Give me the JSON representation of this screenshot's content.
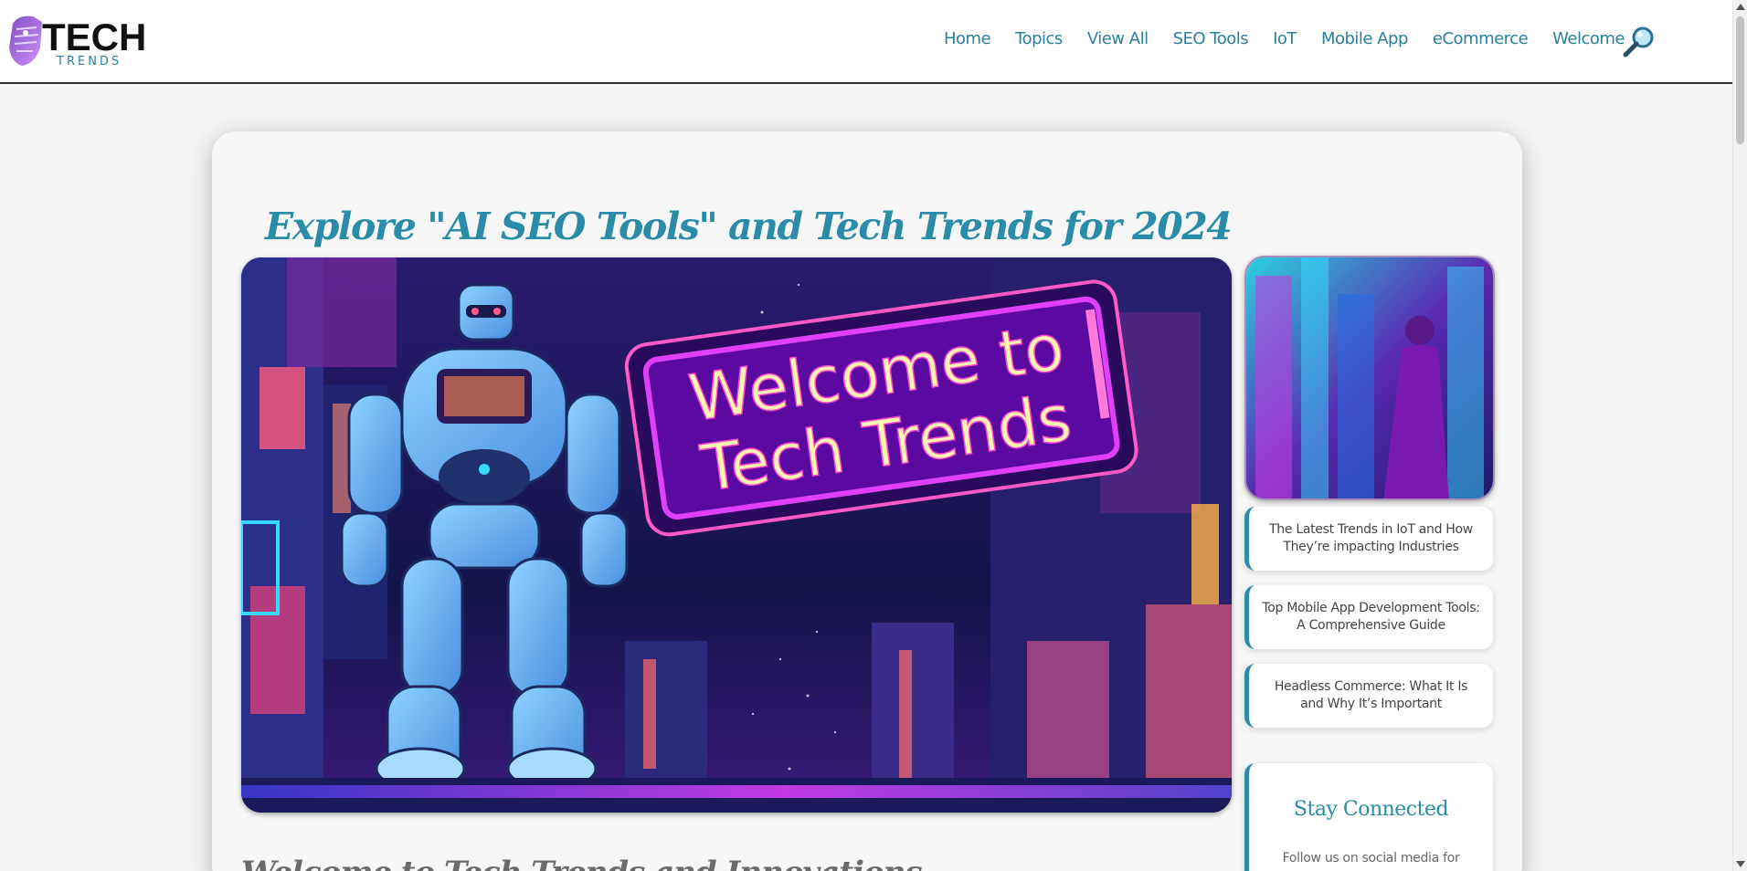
{
  "brand": {
    "logo_main": "TECH",
    "logo_sub": "TRENDS"
  },
  "nav": {
    "items": [
      "Home",
      "Topics",
      "View All",
      "SEO Tools",
      "IoT",
      "Mobile App",
      "eCommerce",
      "Welcome"
    ],
    "search_icon": "magnifier-icon"
  },
  "main": {
    "title": "Explore \"AI SEO Tools\" and Tech Trends for 2024",
    "hero_sign_line1": "Welcome to",
    "hero_sign_line2": "Tech Trends",
    "section_heading": "Welcome to Tech Trends and Innovations"
  },
  "sidebar": {
    "items": [
      "The Latest Trends in IoT and How They’re impacting Industries",
      "Top Mobile App Development Tools: A Comprehensive Guide",
      "Headless Commerce: What It Is and Why It’s Important"
    ],
    "stay_title": "Stay Connected",
    "stay_text": "Follow us on social media for"
  },
  "colors": {
    "accent": "#2a8ca8",
    "nav_link": "#2a7f9e",
    "background": "#f5f5f5"
  }
}
